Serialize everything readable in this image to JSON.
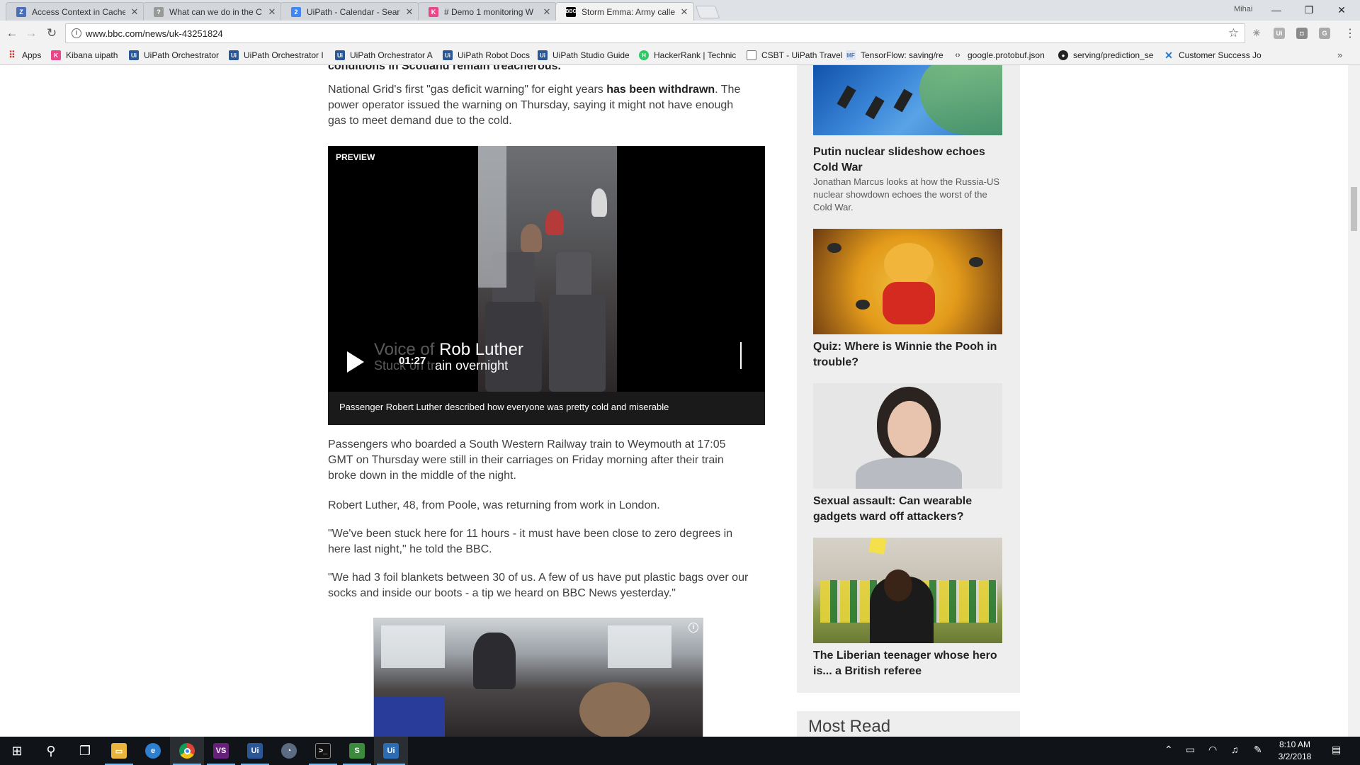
{
  "browser": {
    "tabs": [
      {
        "title": "Access Context in Cache",
        "icon": "uipath-docs-icon",
        "color": "#4a6fb5"
      },
      {
        "title": "What can we do in the C",
        "icon": "forum-icon",
        "color": "#888888"
      },
      {
        "title": "UiPath - Calendar - Sear",
        "icon": "calendar-icon",
        "color": "#4285f4"
      },
      {
        "title": "# Demo 1 monitoring W",
        "icon": "kibana-icon",
        "color": "#e8488b"
      },
      {
        "title": "Storm Emma: Army calle",
        "icon": "bbc-icon",
        "color": "#000000"
      }
    ],
    "user": "Mihai",
    "url": "www.bbc.com/news/uk-43251824",
    "bookmarks": [
      {
        "label": "Apps",
        "icon": "apps-grid-icon",
        "color": "#d93025"
      },
      {
        "label": "Kibana uipath",
        "icon": "kibana-icon",
        "color": "#e8488b"
      },
      {
        "label": "UiPath Orchestrator",
        "icon": "uipath-icon",
        "color": "#2b5797"
      },
      {
        "label": "UiPath Orchestrator I",
        "icon": "uipath-icon",
        "color": "#2b5797"
      },
      {
        "label": "UiPath Orchestrator A",
        "icon": "uipath-icon",
        "color": "#2b5797"
      },
      {
        "label": "UiPath Robot Docs",
        "icon": "uipath-icon",
        "color": "#2b5797"
      },
      {
        "label": "UiPath Studio Guide",
        "icon": "uipath-icon",
        "color": "#2b5797"
      },
      {
        "label": "HackerRank | Technic",
        "icon": "hackerrank-icon",
        "color": "#2ec866"
      },
      {
        "label": "CSBT - UiPath Travel",
        "icon": "page-icon",
        "color": "#777777"
      },
      {
        "label": "TensorFlow: saving/re",
        "icon": "mf-icon",
        "color": "#5577aa"
      },
      {
        "label": "google.protobuf.json",
        "icon": "code-icon",
        "color": "#555555"
      },
      {
        "label": "serving/prediction_se",
        "icon": "github-icon",
        "color": "#222222"
      },
      {
        "label": "Customer Success Jo",
        "icon": "confluence-icon",
        "color": "#1f78d1"
      }
    ]
  },
  "article": {
    "cut_line": "conditions in Scotland remain treacherous.",
    "para1_before": "National Grid's first \"gas deficit warning\" for eight years ",
    "para1_link": "has been withdrawn",
    "para1_after": ". The power operator issued the warning on Thursday, saying it might not have enough gas to meet demand due to the cold.",
    "video": {
      "preview_label": "PREVIEW",
      "duration": "01:27",
      "overlay_line1_dim": "Voice of ",
      "overlay_line1": "Rob Luther",
      "overlay_line2_dim": "Stuck on tr",
      "overlay_line2": "ain overnight",
      "caption": "Passenger Robert Luther described how everyone was pretty cold and miserable"
    },
    "para2": "Passengers who boarded a South Western Railway train to Weymouth at 17:05 GMT on Thursday were still in their carriages on Friday morning after their train broke down in the middle of the night.",
    "para3": "Robert Luther, 48, from Poole, was returning from work in London.",
    "para4": "\"We've been stuck here for 11 hours - it must have been close to zero degrees in here last night,\" he told the BBC.",
    "para5": "\"We had 3 foil blankets between 30 of us. A few of us have put plastic bags over our socks and inside our boots - a tip we heard on BBC News yesterday.\""
  },
  "sidebar": {
    "stories": [
      {
        "title": "Putin nuclear slideshow echoes Cold War",
        "desc": "Jonathan Marcus looks at how the Russia-US nuclear showdown echoes the worst of the Cold War."
      },
      {
        "title": "Quiz: Where is Winnie the Pooh in trouble?",
        "desc": ""
      },
      {
        "title": "Sexual assault: Can wearable gadgets ward off attackers?",
        "desc": ""
      },
      {
        "title": "The Liberian teenager whose hero is... a British referee",
        "desc": ""
      }
    ],
    "most_read": "Most Read"
  },
  "taskbar": {
    "time": "8:10 AM",
    "date": "3/2/2018"
  }
}
